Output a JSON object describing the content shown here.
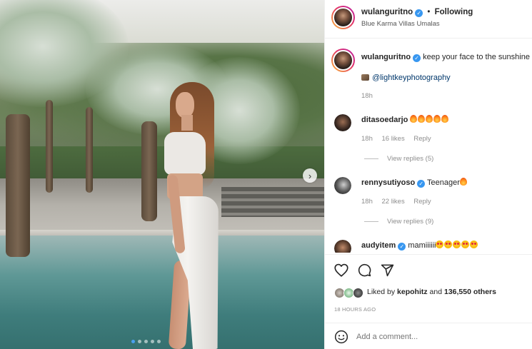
{
  "post": {
    "author": "wulanguritno",
    "follow_separator": "•",
    "follow_label": "Following",
    "location": "Blue Karma Villas Umalas",
    "caption": "keep your face to the sunshine",
    "photo_credit": "@lightkeyphotography",
    "caption_time": "18h",
    "carousel_dots": 5,
    "carousel_active": 1
  },
  "comments": [
    {
      "user": "ditasoedarjo",
      "verified": false,
      "text": "",
      "emoji": [
        "fire",
        "fire",
        "fire",
        "fire",
        "fire"
      ],
      "time": "18h",
      "likes": "16 likes",
      "reply": "Reply",
      "view_replies": "View replies (5)"
    },
    {
      "user": "rennysutiyoso",
      "verified": true,
      "text": "Teenager",
      "emoji": [
        "fire"
      ],
      "time": "18h",
      "likes": "22 likes",
      "reply": "Reply",
      "view_replies": "View replies (9)"
    },
    {
      "user": "audyitem",
      "verified": true,
      "text": "mamiiiiii",
      "emoji": [
        "love",
        "love",
        "love",
        "love",
        "love"
      ]
    }
  ],
  "actions": {
    "like_icon": "heart-icon",
    "comment_icon": "comment-icon",
    "share_icon": "share-icon"
  },
  "likes": {
    "prefix": "Liked by",
    "user": "kepohitz",
    "conjunction": "and",
    "others": "136,550 others"
  },
  "timestamp": "18 HOURS AGO",
  "add_comment": {
    "placeholder": "Add a comment...",
    "emoji_icon": "smiley-icon"
  },
  "colors": {
    "verified": "#3897f0",
    "muted": "#8e8e8e",
    "text": "#262626",
    "carousel_active": "#4aa0f0"
  }
}
